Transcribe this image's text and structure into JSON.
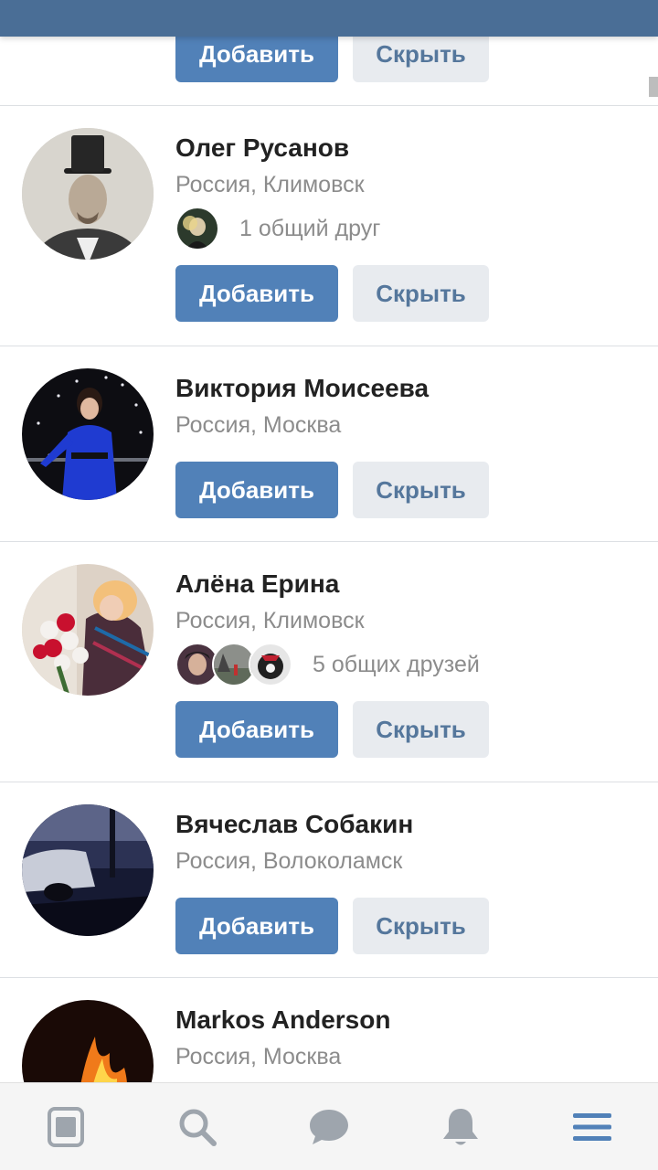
{
  "top_card": {
    "add_label": "Добавить",
    "hide_label": "Скрыть"
  },
  "people": [
    {
      "name": "Олег Русанов",
      "city": "Россия, Климовск",
      "mutual_text": "1 общий друг",
      "add_label": "Добавить",
      "hide_label": "Скрыть"
    },
    {
      "name": "Виктория Моисеева",
      "city": "Россия, Москва",
      "add_label": "Добавить",
      "hide_label": "Скрыть"
    },
    {
      "name": "Алёна Ерина",
      "city": "Россия, Климовск",
      "mutual_text": "5 общих друзей",
      "add_label": "Добавить",
      "hide_label": "Скрыть"
    },
    {
      "name": "Вячеслав Собакин",
      "city": "Россия, Волоколамск",
      "add_label": "Добавить",
      "hide_label": "Скрыть"
    },
    {
      "name": "Markos Anderson",
      "city": "Россия, Москва"
    }
  ],
  "tabbar": {
    "icons": [
      "news-icon",
      "search-icon",
      "messages-icon",
      "notifications-icon",
      "menu-icon"
    ],
    "active": "menu-icon"
  },
  "colors": {
    "header": "#4a6e96",
    "add_button": "#5181b8",
    "hide_button": "#e8ebef",
    "active_tab": "#5181b8",
    "inactive_tab": "#9ea5ad"
  }
}
